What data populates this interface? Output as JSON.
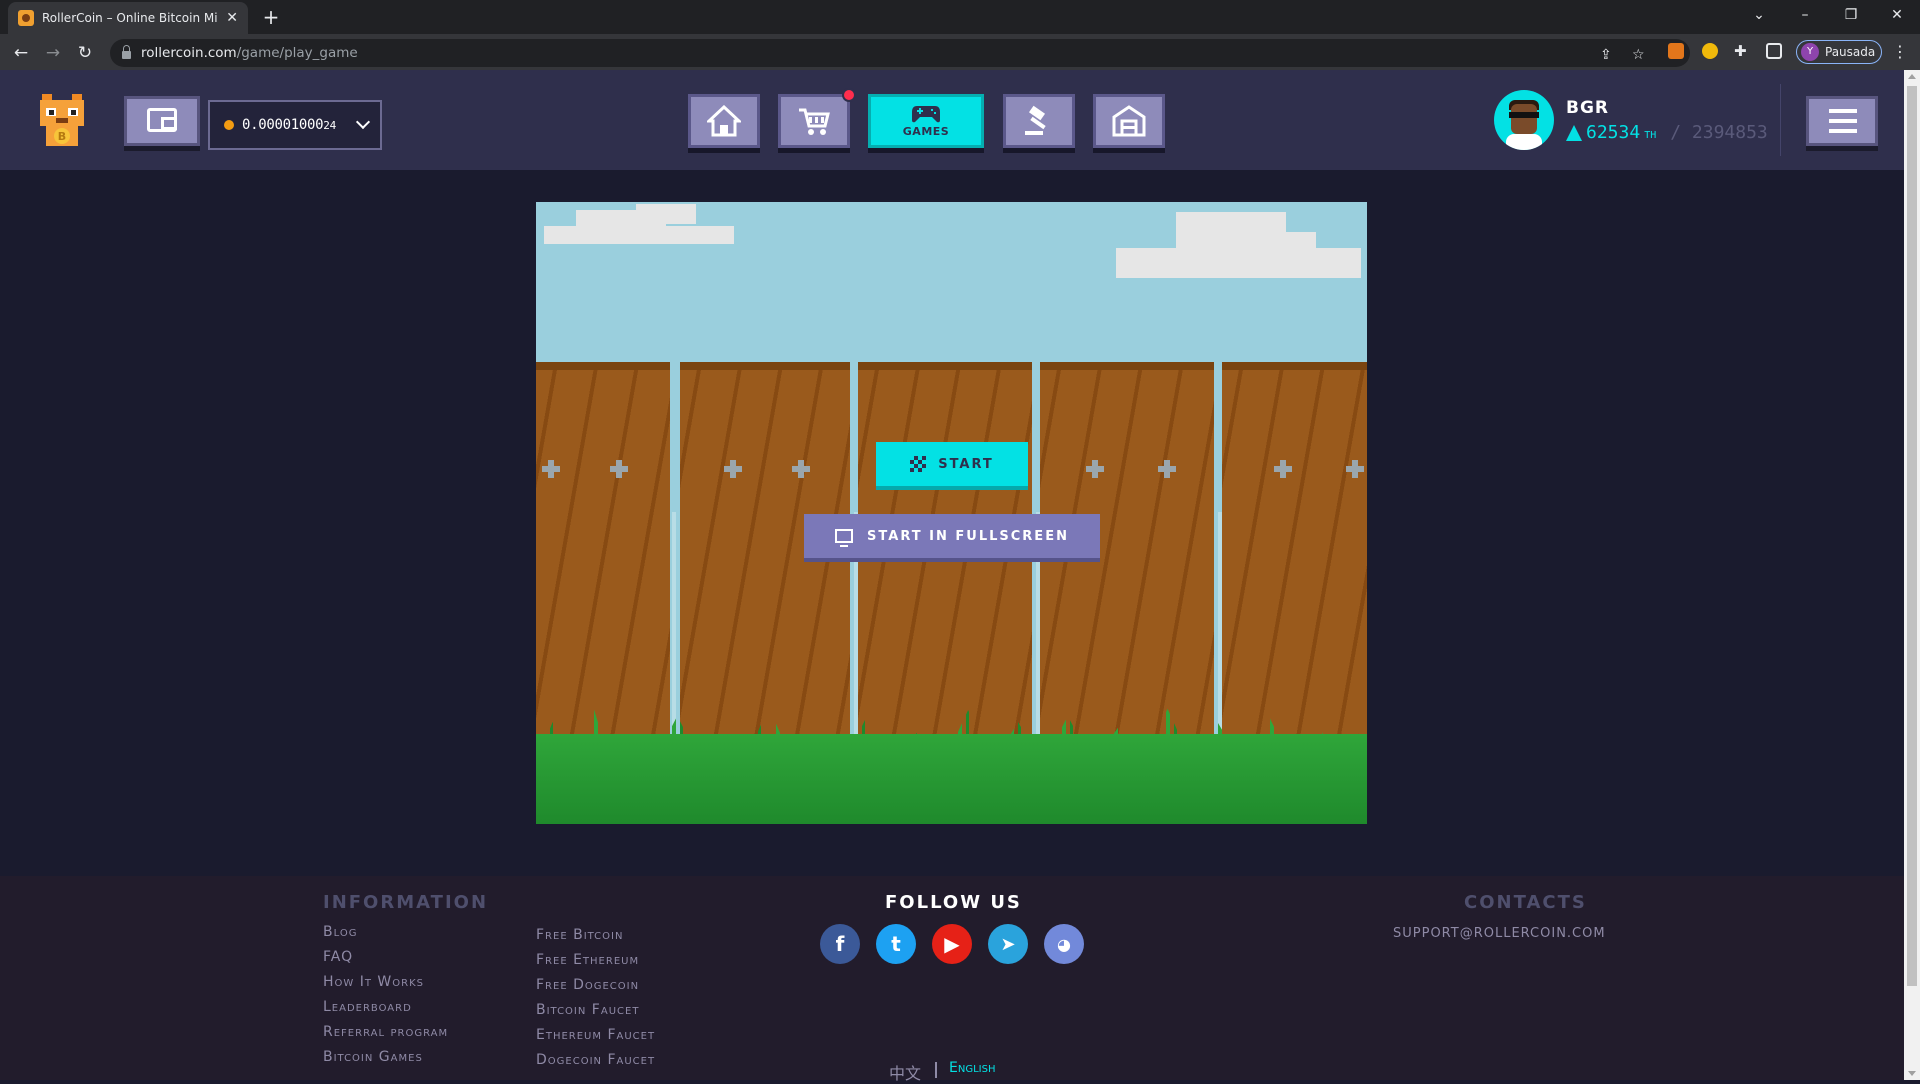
{
  "browser": {
    "tab_title": "RollerCoin – Online Bitcoin Minin",
    "url_host": "rollercoin.com",
    "url_path": "/game/play_game",
    "profile_initial": "Y",
    "profile_label": "Pausada"
  },
  "header": {
    "balance": "0.00001000",
    "balance_small": "24",
    "nav": [
      {
        "id": "home",
        "label": ""
      },
      {
        "id": "market",
        "label": ""
      },
      {
        "id": "games",
        "label": "GAMES"
      },
      {
        "id": "marketplace",
        "label": ""
      },
      {
        "id": "storage",
        "label": ""
      }
    ],
    "username": "BGR",
    "power": "62534",
    "power_unit": "TH",
    "power_total": "/ 2394853"
  },
  "game": {
    "start_label": "Start",
    "fullscreen_label": "Start in fullscreen"
  },
  "footer": {
    "information_heading": "Information",
    "info_links": [
      "Blog",
      "FAQ",
      "How It Works",
      "Leaderboard",
      "Referral program",
      "Bitcoin Games"
    ],
    "coin_links": [
      "Free Bitcoin",
      "Free Ethereum",
      "Free Dogecoin",
      "Bitcoin Faucet",
      "Ethereum Faucet",
      "Dogecoin Faucet"
    ],
    "follow_heading": "Follow us",
    "socials": [
      "facebook",
      "twitter",
      "youtube",
      "telegram",
      "discord"
    ],
    "contacts_heading": "Contacts",
    "email": "SUPPORT@ROLLERCOIN.COM",
    "languages": [
      "中文",
      "English"
    ]
  },
  "colors": {
    "accent": "#03e1e4",
    "header_bg": "#2f2f4c",
    "page_bg": "#1a1b2e",
    "button_purple": "#8e8bba"
  }
}
